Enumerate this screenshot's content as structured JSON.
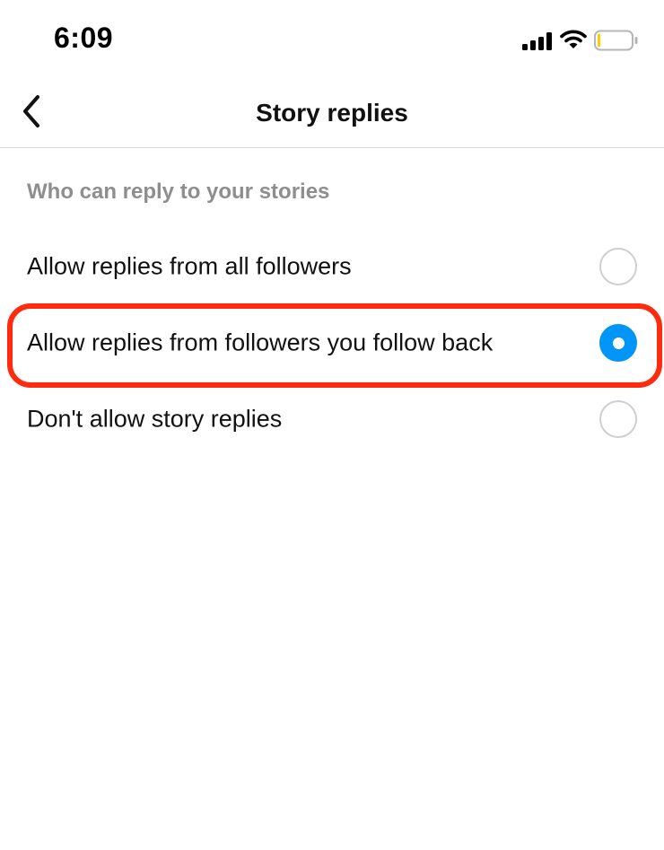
{
  "status_bar": {
    "time": "6:09",
    "signal_icon": "cellular-signal-icon",
    "wifi_icon": "wifi-icon",
    "battery_icon": "battery-icon",
    "battery_level": 0.08
  },
  "nav": {
    "back_icon": "chevron-left-icon",
    "title": "Story replies"
  },
  "section": {
    "header": "Who can reply to your stories"
  },
  "options": [
    {
      "label": "Allow replies from all followers",
      "selected": false
    },
    {
      "label": "Allow replies from followers you follow back",
      "selected": true
    },
    {
      "label": "Don't allow story replies",
      "selected": false
    }
  ],
  "colors": {
    "accent": "#0095f6",
    "highlight": "#ff2b0e",
    "battery_low": "#ffcc00",
    "muted_text": "#8e8e8e"
  }
}
